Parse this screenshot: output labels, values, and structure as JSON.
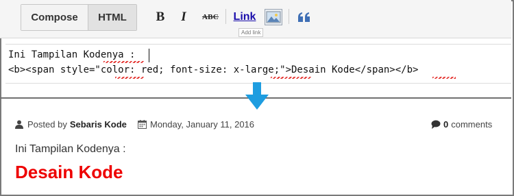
{
  "toolbar": {
    "compose_label": "Compose",
    "html_label": "HTML",
    "bold_label": "B",
    "italic_label": "I",
    "strike_label": "ABC",
    "link_label": "Link",
    "link_tooltip": "Add link",
    "icons": [
      "bold-icon",
      "italic-icon",
      "strikethrough-icon",
      "image-icon",
      "quote-icon"
    ]
  },
  "editor": {
    "line1": "Ini Tampilan Kodenya :",
    "line2": "<b><span style=\"color: red; font-size: x-large;\">Desain Kode</span></b>"
  },
  "post": {
    "posted_by_label": "Posted by",
    "author": "Sebaris Kode",
    "date": "Monday, January 11, 2016",
    "comment_count": "0",
    "comments_label": "comments",
    "body_text": "Ini Tampilan Kodenya :",
    "title": "Desain Kode"
  },
  "colors": {
    "arrow": "#1e9de0",
    "title": "#ee0000",
    "link": "#1a0dab",
    "quote_icon": "#3f6fb5"
  }
}
